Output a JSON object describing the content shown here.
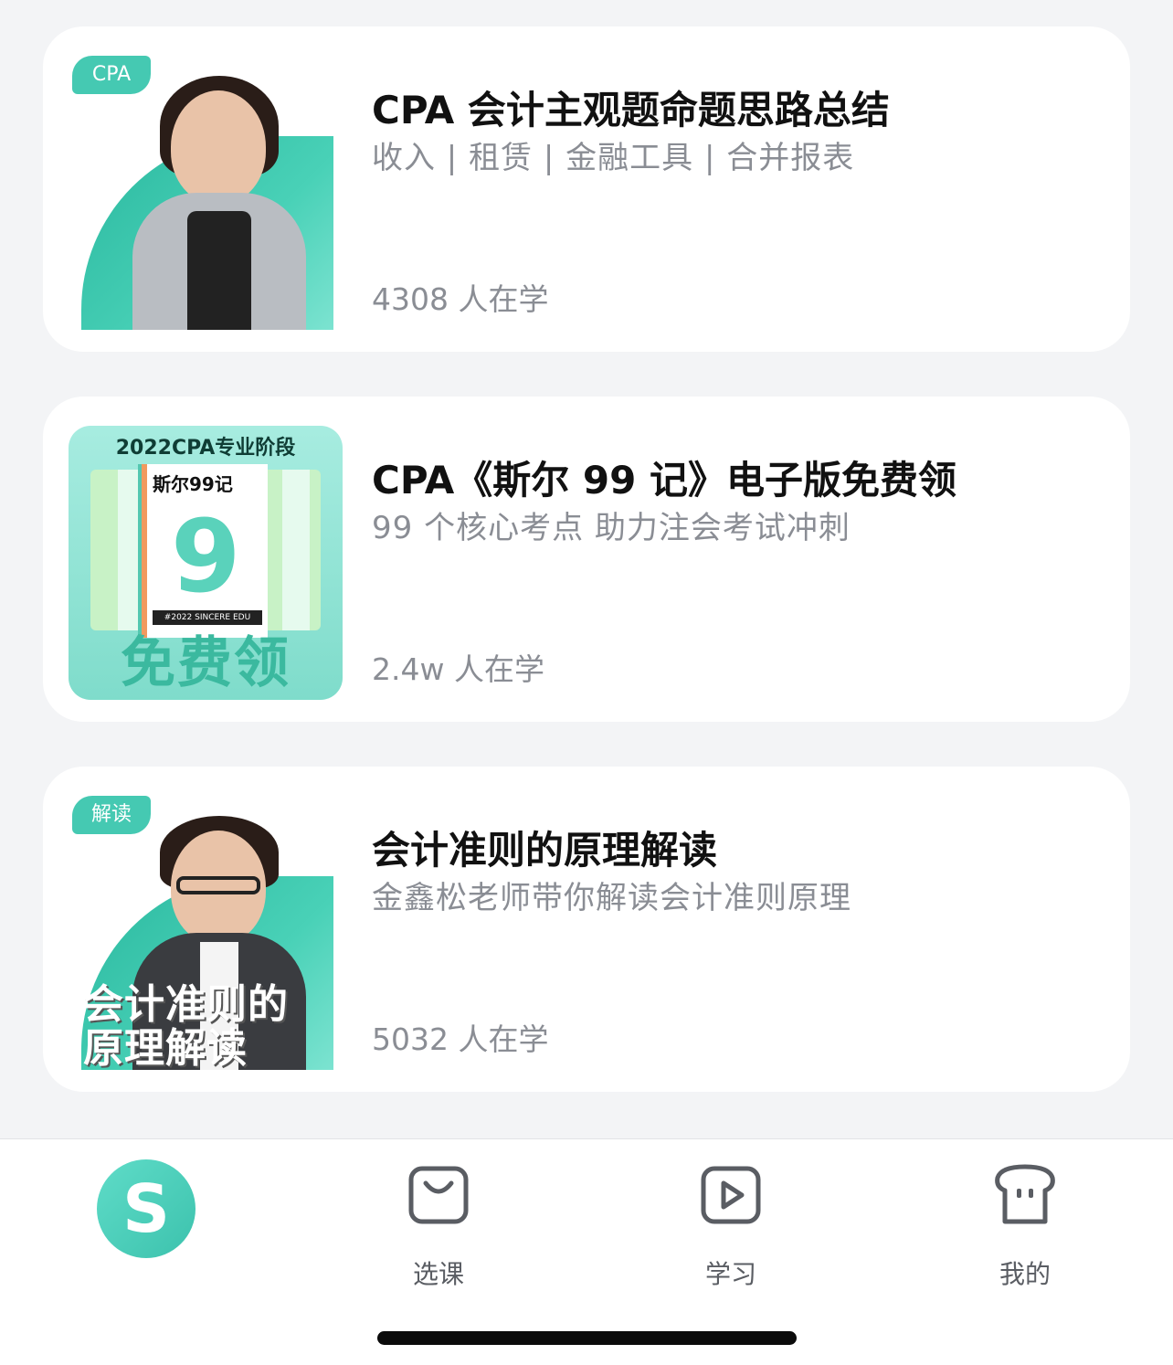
{
  "courses": [
    {
      "tag": "CPA",
      "title": "CPA 会计主观题命题思路总结",
      "subtitle": "收入 | 租赁 | 金融工具 | 合并报表",
      "learners": "4308 人在学"
    },
    {
      "book": {
        "top_text": "2022CPA专业阶段",
        "title": "斯尔99记",
        "nine": "9",
        "footer": "#2022 SINCERE EDU",
        "badge": "免费领"
      },
      "title": "CPA《斯尔 99 记》电子版免费领",
      "subtitle": "99 个核心考点 助力注会考试冲刺",
      "learners": "2.4w 人在学"
    },
    {
      "tag": "解读",
      "overlay_line1": "会计准则的",
      "overlay_line2": "原理解读",
      "title": "会计准则的原理解读",
      "subtitle": "金鑫松老师带你解读会计准则原理",
      "learners": "5032 人在学"
    }
  ],
  "tabbar": {
    "home_glyph": "S",
    "items": [
      {
        "label": "选课",
        "icon": "bag-icon"
      },
      {
        "label": "学习",
        "icon": "play-icon"
      },
      {
        "label": "我的",
        "icon": "toast-face-icon"
      }
    ],
    "accent": "#45c9b2"
  }
}
